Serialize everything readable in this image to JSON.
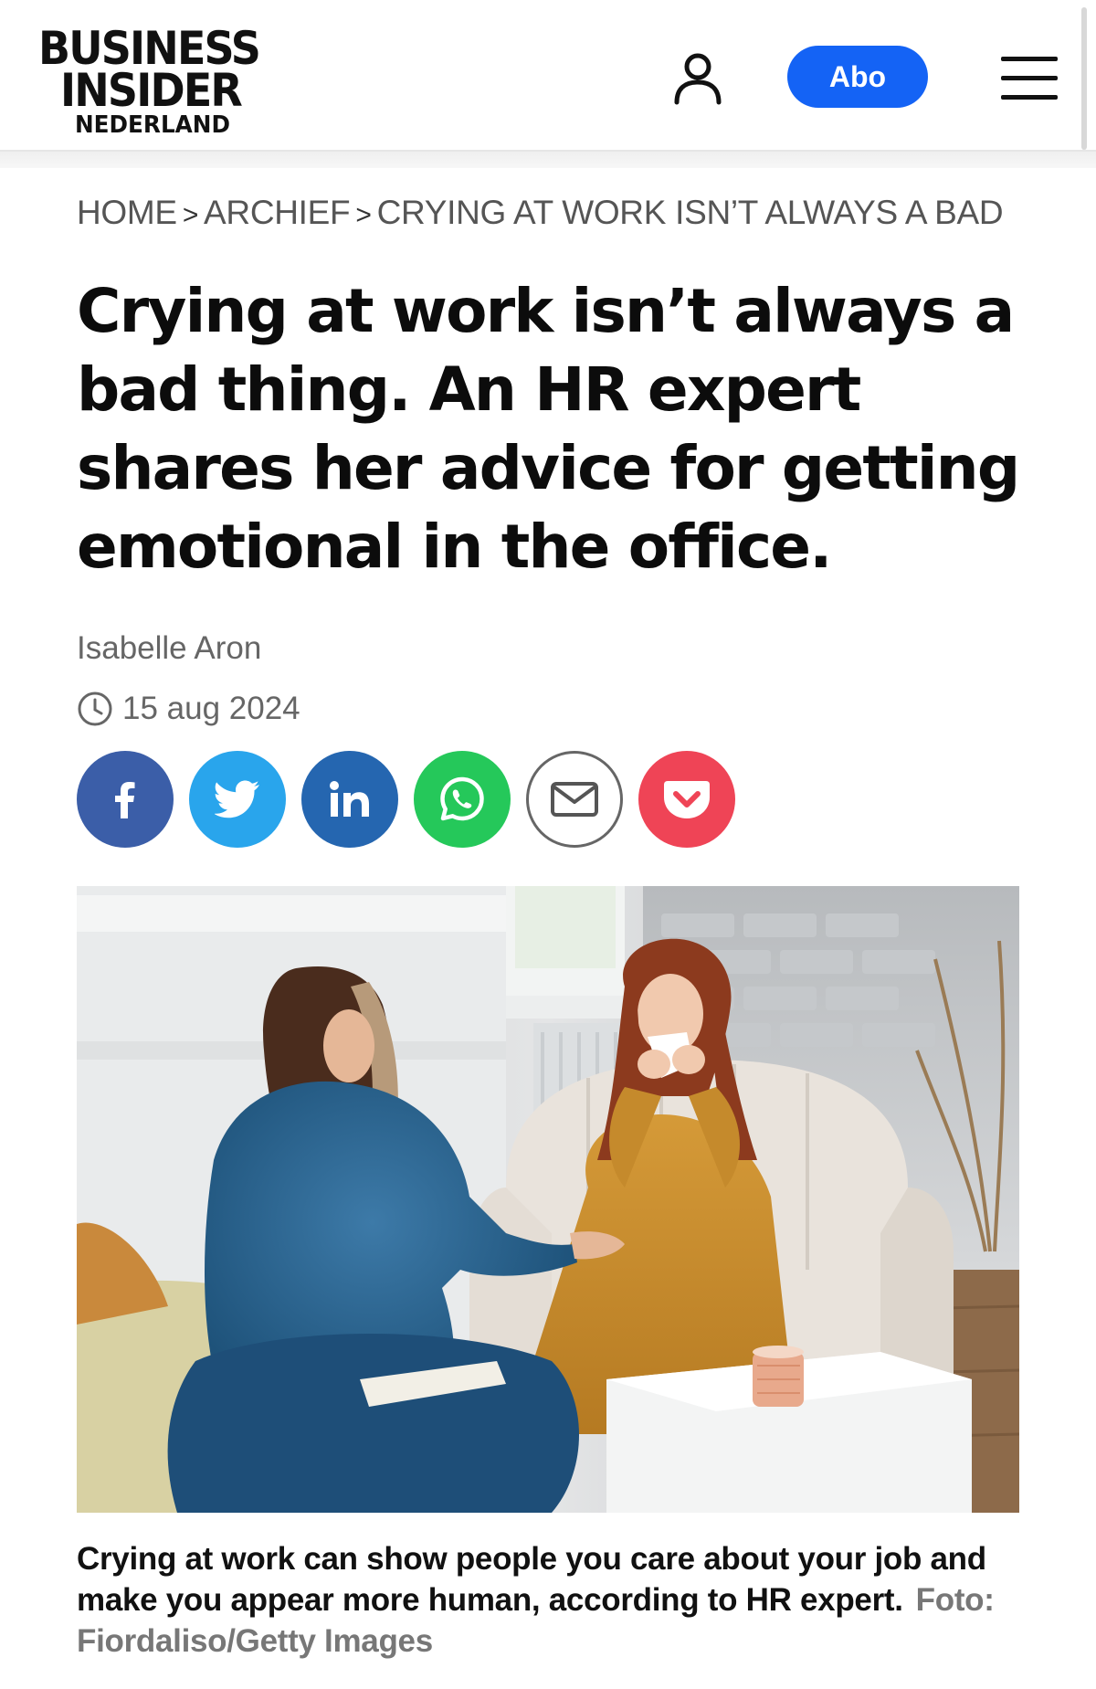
{
  "header": {
    "logo": {
      "line1": "BUSINESS",
      "line2": "INSIDER",
      "line3": "NEDERLAND"
    },
    "user_icon": "user-icon",
    "subscribe_label": "Abo",
    "menu_icon": "hamburger-menu-icon"
  },
  "breadcrumb": {
    "items": [
      "HOME",
      "ARCHIEF",
      "CRYING AT WORK ISN’T ALWAYS A BAD"
    ],
    "separator": ">"
  },
  "article": {
    "title": "Crying at work isn’t always a bad thing. An HR expert shares her advice for getting emotional in the office.",
    "author": "Isabelle Aron",
    "date": "15 aug 2024",
    "date_icon": "clock-icon"
  },
  "share": {
    "buttons": [
      {
        "name": "facebook",
        "icon": "facebook-icon",
        "color": "#3b5ea8"
      },
      {
        "name": "twitter",
        "icon": "twitter-icon",
        "color": "#29a5ec"
      },
      {
        "name": "linkedin",
        "icon": "linkedin-icon",
        "color": "#2566b0"
      },
      {
        "name": "whatsapp",
        "icon": "whatsapp-icon",
        "color": "#25c85a"
      },
      {
        "name": "email",
        "icon": "mail-icon",
        "color": "#ffffff"
      },
      {
        "name": "pocket",
        "icon": "pocket-icon",
        "color": "#ef4456"
      }
    ]
  },
  "image": {
    "caption": "Crying at work can show people you care about your job and make you appear more human, according to HR expert.",
    "credit": "Foto: Fiordaliso/Getty Images"
  },
  "colors": {
    "accent": "#1463f5",
    "text": "#0c0c0c",
    "muted": "#666666"
  }
}
